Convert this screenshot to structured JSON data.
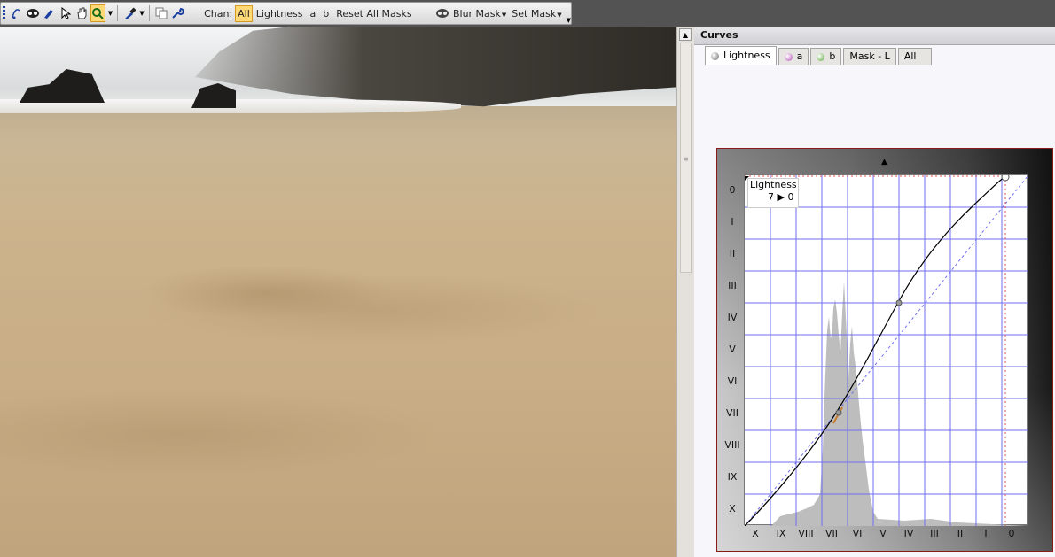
{
  "toolbar": {
    "tools": [
      "curve-tool-icon",
      "mask-tool-icon",
      "brush-tool-icon",
      "pointer-tool-icon",
      "hand-tool-icon",
      "zoom-tool-icon",
      "eyedropper-icon",
      "copy-icon",
      "wrench-icon"
    ],
    "chan_label": "Chan:",
    "chan_all": "All",
    "chan_lightness": "Lightness",
    "chan_a": "a",
    "chan_b": "b",
    "reset_all_masks": "Reset All Masks",
    "blur_mask": "Blur Mask",
    "set_mask": "Set Mask"
  },
  "panel": {
    "title": "Curves",
    "tabs": [
      {
        "label": "Lightness",
        "active": true,
        "dot": "#777777"
      },
      {
        "label": "a",
        "active": false,
        "dot": "#b64fb8"
      },
      {
        "label": "b",
        "active": false,
        "dot": "#5aa83c"
      },
      {
        "label": "Mask - L",
        "active": false
      },
      {
        "label": "All",
        "active": false
      }
    ]
  },
  "curves": {
    "channel": "Lightness",
    "readout": "7 ▶ 0",
    "y_labels": [
      "0",
      "I",
      "II",
      "III",
      "IV",
      "V",
      "VI",
      "VII",
      "VIII",
      "IX",
      "X"
    ],
    "x_labels": [
      "X",
      "IX",
      "VIII",
      "VII",
      "VI",
      "V",
      "IV",
      "III",
      "II",
      "I",
      "0"
    ],
    "curve_color": "#000000",
    "grid_color": "#6f6ff0"
  }
}
